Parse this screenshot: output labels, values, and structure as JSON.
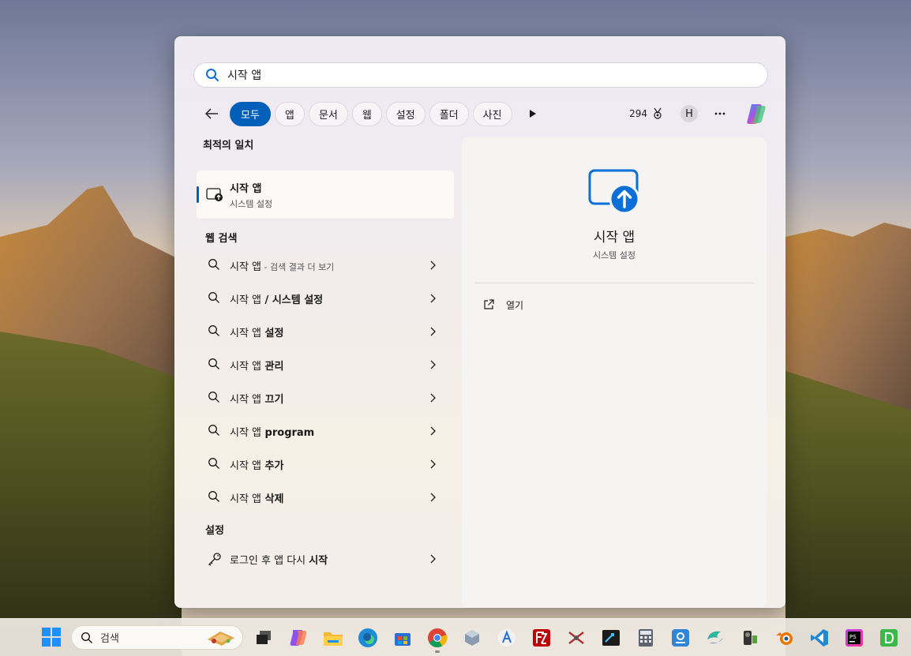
{
  "search": {
    "value": "시작 앱",
    "placeholder": ""
  },
  "filters": {
    "chips": [
      {
        "label": "모두",
        "active": true
      },
      {
        "label": "앱",
        "active": false
      },
      {
        "label": "문서",
        "active": false
      },
      {
        "label": "웹",
        "active": false
      },
      {
        "label": "설정",
        "active": false
      },
      {
        "label": "폴더",
        "active": false
      },
      {
        "label": "사진",
        "active": false
      }
    ],
    "points": "294",
    "avatar_initial": "H"
  },
  "left": {
    "best_match_title": "최적의 일치",
    "best_match": {
      "title": "시작 앱",
      "subtitle": "시스템 설정"
    },
    "web_title": "웹 검색",
    "web_results": [
      {
        "prefix": "시작 앱",
        "bold": "",
        "hint": " - 검색 결과 더 보기"
      },
      {
        "prefix": "시작 앱",
        "bold": " / 시스템 설정",
        "hint": ""
      },
      {
        "prefix": "시작 앱",
        "bold": " 설정",
        "hint": ""
      },
      {
        "prefix": "시작 앱",
        "bold": " 관리",
        "hint": ""
      },
      {
        "prefix": "시작 앱",
        "bold": " 끄기",
        "hint": ""
      },
      {
        "prefix": "시작 앱",
        "bold": " program",
        "hint": ""
      },
      {
        "prefix": "시작 앱",
        "bold": " 추가",
        "hint": ""
      },
      {
        "prefix": "시작 앱",
        "bold": " 삭제",
        "hint": ""
      }
    ],
    "settings_title": "설정",
    "settings_result": {
      "prefix": "로그인 후 앱 다시 ",
      "bold": "시작"
    }
  },
  "right": {
    "title": "시작 앱",
    "subtitle": "시스템 설정",
    "action_label": "열기"
  },
  "taskbar": {
    "search_label": "검색",
    "apps": [
      "task-view-icon",
      "copilot-app-icon",
      "file-explorer-icon",
      "edge-icon",
      "store-icon",
      "chrome-icon",
      "cube-app-icon",
      "translate-app-icon",
      "filezilla-icon",
      "game-app-icon",
      "screen-recorder-icon",
      "calculator-icon",
      "hangul-icon",
      "teams-like-icon",
      "camera-app-icon",
      "blender-icon",
      "vscode-icon",
      "phpstorm-icon",
      "dbeaver-like-icon"
    ]
  },
  "colors": {
    "accent": "#005fb8",
    "hero_blue": "#0a6fd6"
  }
}
